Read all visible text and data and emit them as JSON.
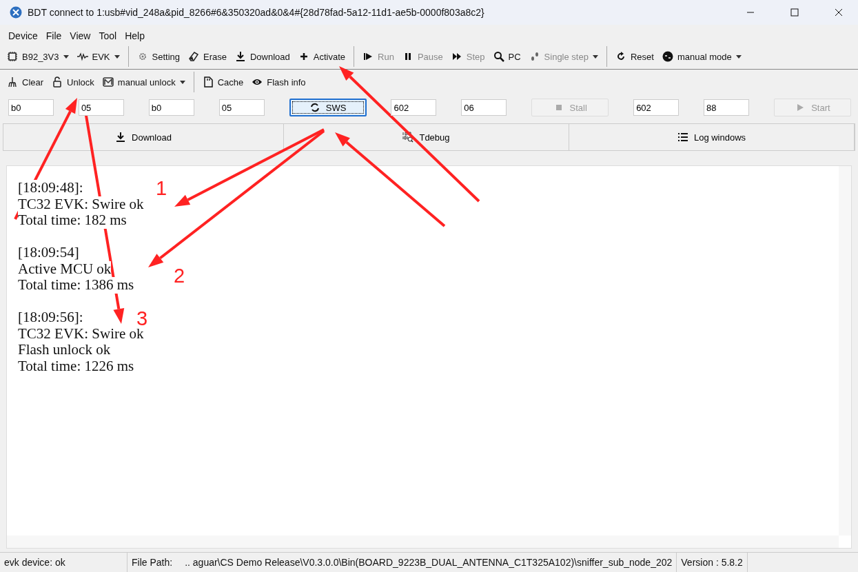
{
  "window": {
    "title": "BDT connect to 1:usb#vid_248a&pid_8266#6&350320ad&0&4#{28d78fad-5a12-11d1-ae5b-0000f803a8c2}"
  },
  "menu": [
    "Device",
    "File",
    "View",
    "Tool",
    "Help"
  ],
  "toolbar_1": [
    [
      {
        "label": "B92_3V3",
        "dropdown": true,
        "disabled": false
      },
      {
        "label": "EVK",
        "dropdown": true,
        "disabled": false
      }
    ],
    [
      {
        "label": "Setting",
        "dropdown": false,
        "disabled": false
      },
      {
        "label": "Erase",
        "dropdown": false,
        "disabled": false
      },
      {
        "label": "Download",
        "dropdown": false,
        "disabled": false
      },
      {
        "label": "Activate",
        "dropdown": false,
        "disabled": false
      }
    ],
    [
      {
        "label": "Run",
        "dropdown": false,
        "disabled": true
      },
      {
        "label": "Pause",
        "dropdown": false,
        "disabled": true
      },
      {
        "label": "Step",
        "dropdown": false,
        "disabled": true
      },
      {
        "label": "PC",
        "dropdown": false,
        "disabled": false
      },
      {
        "label": "Single step",
        "dropdown": true,
        "disabled": true
      }
    ],
    [
      {
        "label": "Reset",
        "dropdown": false,
        "disabled": false
      },
      {
        "label": "manual mode",
        "dropdown": true,
        "disabled": false
      }
    ]
  ],
  "toolbar_2": [
    [
      {
        "label": "Clear",
        "dropdown": false,
        "disabled": false
      },
      {
        "label": "Unlock",
        "dropdown": false,
        "disabled": false
      },
      {
        "label": "manual unlock",
        "dropdown": true,
        "disabled": false
      }
    ],
    [
      {
        "label": "Cache",
        "dropdown": false,
        "disabled": false
      },
      {
        "label": "Flash info",
        "dropdown": false,
        "disabled": false
      }
    ]
  ],
  "controls": [
    {
      "kind": "field",
      "value": "b0"
    },
    {
      "kind": "field",
      "value": "05"
    },
    {
      "kind": "field",
      "value": "b0"
    },
    {
      "kind": "field",
      "value": "05"
    },
    {
      "kind": "button",
      "label": "SWS",
      "disabled": false
    },
    {
      "kind": "field",
      "value": "602"
    },
    {
      "kind": "field",
      "value": "06"
    },
    {
      "kind": "button",
      "label": "Stall",
      "disabled": true
    },
    {
      "kind": "field",
      "value": "602"
    },
    {
      "kind": "field",
      "value": "88"
    },
    {
      "kind": "button",
      "label": "Start",
      "disabled": true
    }
  ],
  "tabs": [
    {
      "label": "Download",
      "selected": false
    },
    {
      "label": "Tdebug",
      "selected": false
    },
    {
      "label": "Log windows",
      "selected": false
    }
  ],
  "log": [
    [
      "[18:09:48]:",
      "TC32 EVK: Swire ok",
      "Total time: 182 ms"
    ],
    [
      "[18:09:54]",
      "Active MCU ok",
      "Total time: 1386 ms"
    ],
    [
      "[18:09:56]:",
      "TC32 EVK: Swire ok",
      "Flash unlock ok",
      "Total time: 1226 ms"
    ]
  ],
  "annotations": [
    "1",
    "2",
    "3"
  ],
  "status_bar": {
    "device": "evk device: ok",
    "file_path_label": "File Path:",
    "file_path": "..  aguar\\CS Demo Release\\V0.3.0.0\\Bin(BOARD_9223B_DUAL_ANTENNA_C1T325A102)\\sniffer_sub_node_202",
    "version": "Version : 5.8.2"
  }
}
